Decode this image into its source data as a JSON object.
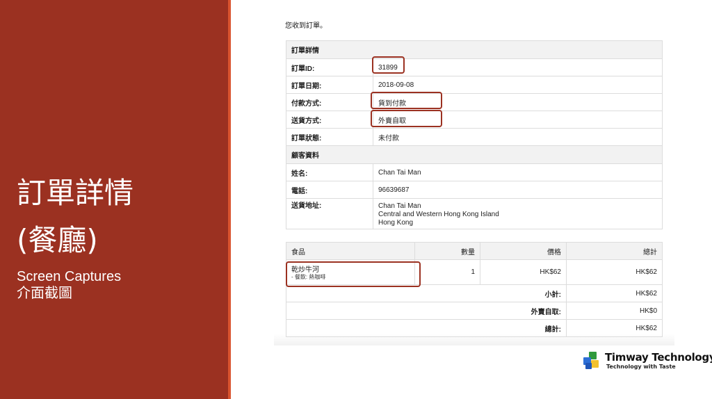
{
  "slide": {
    "title_line1": "訂單詳情",
    "title_line2": "(餐廳)",
    "subtitle_line1": "Screen Captures",
    "subtitle_line2": "介面截圖"
  },
  "email": {
    "intro": "您收到訂單。",
    "order_section": {
      "heading": "訂單詳情",
      "rows": [
        {
          "label": "訂單ID:",
          "value": "31899"
        },
        {
          "label": "訂單日期:",
          "value": "2018-09-08"
        },
        {
          "label": "付款方式:",
          "value": "貨到付款"
        },
        {
          "label": "送貨方式:",
          "value": "外賣自取"
        },
        {
          "label": "訂單狀態:",
          "value": "未付款"
        }
      ]
    },
    "customer_section": {
      "heading": "顧客資料",
      "rows": [
        {
          "label": "姓名:",
          "value": "Chan Tai Man"
        },
        {
          "label": "電話:",
          "value": "96639687"
        }
      ],
      "address_label": "送貨地址:",
      "address_lines": [
        "Chan Tai Man",
        "Central and Western Hong Kong Island",
        "Hong Kong"
      ]
    },
    "items_table": {
      "headers": {
        "item": "食品",
        "qty": "數量",
        "price": "價格",
        "total": "總計"
      },
      "items": [
        {
          "name": "乾炒牛河",
          "meta": "- 餐飲: 熱咖啡",
          "qty": "1",
          "price": "HK$62",
          "total": "HK$62"
        }
      ],
      "totals": [
        {
          "label": "小計:",
          "value": "HK$62"
        },
        {
          "label": "外賣自取:",
          "value": "HK$0"
        },
        {
          "label": "總計:",
          "value": "HK$62"
        }
      ]
    }
  },
  "logo": {
    "name": "Timway Technology",
    "tagline": "Technology with Taste",
    "icon": "colored-cubes-icon"
  },
  "colors": {
    "panel": "#9b3121",
    "stripe": "#d9542f",
    "highlight": "#9b3121"
  }
}
